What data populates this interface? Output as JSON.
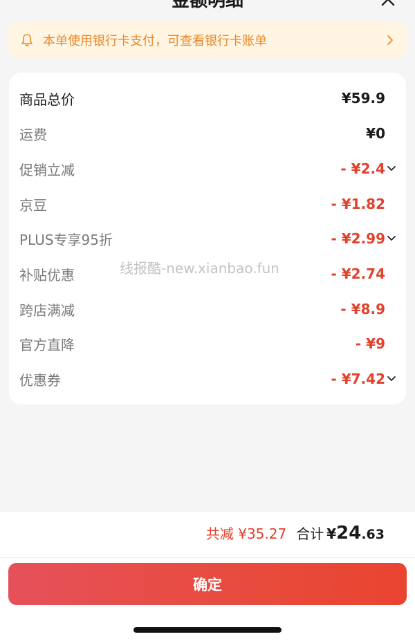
{
  "header": {
    "title": "金额明细"
  },
  "notice": {
    "text": "本单使用银行卡支付，可查看银行卡账单"
  },
  "rows": [
    {
      "label": "商品总价",
      "value": "¥59.9"
    },
    {
      "label": "运费",
      "value": "¥0"
    },
    {
      "label": "促销立减",
      "value": "- ¥2.4"
    },
    {
      "label": "京豆",
      "value": "- ¥1.82"
    },
    {
      "label": "PLUS专享95折",
      "value": "- ¥2.99"
    },
    {
      "label": "补贴优惠",
      "value": "- ¥2.74"
    },
    {
      "label": "跨店满减",
      "value": "- ¥8.9"
    },
    {
      "label": "官方直降",
      "value": "- ¥9"
    },
    {
      "label": "优惠券",
      "value": "- ¥7.42"
    }
  ],
  "watermark": "线报酷-new.xianbao.fun",
  "summary": {
    "reduce_text": "共减 ¥35.27",
    "total_label": "合计",
    "total_sign": "¥",
    "total_int": "24",
    "total_dec": ".63"
  },
  "confirm_label": "确定",
  "colors": {
    "accent": "#e2412c",
    "notice_text": "#e8892b",
    "notice_bg": "#fff5e2"
  },
  "icons": [
    "close-icon",
    "bell-icon",
    "chevron-right-icon",
    "chevron-down-icon"
  ]
}
